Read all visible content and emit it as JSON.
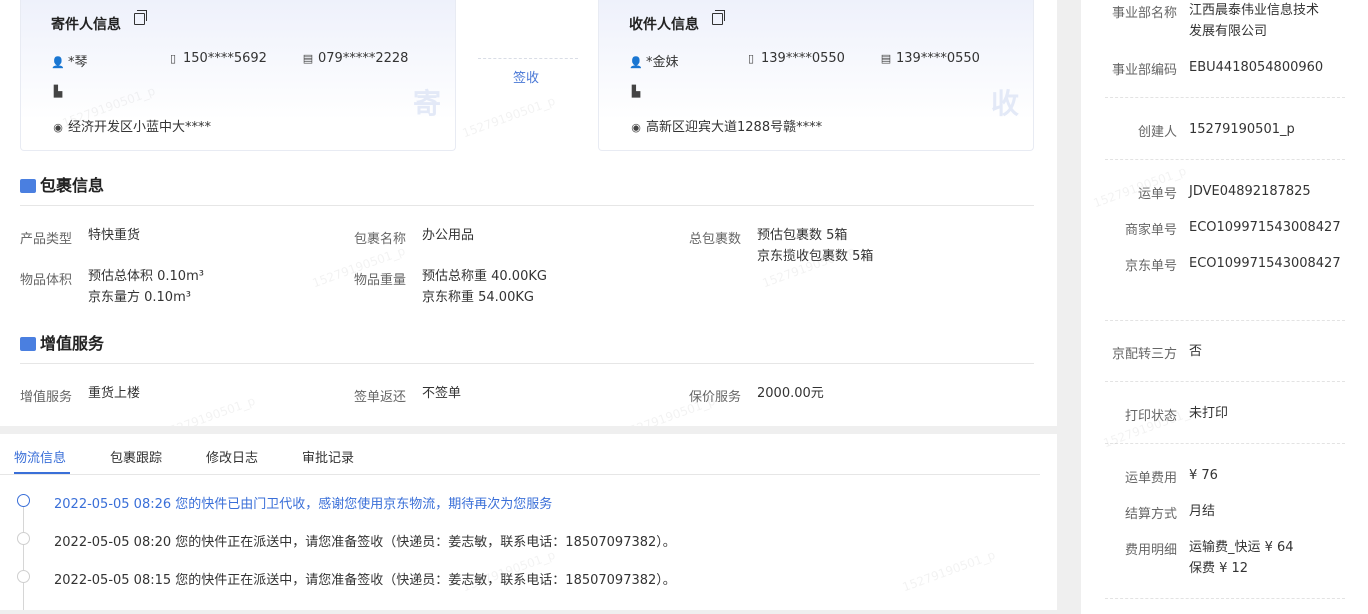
{
  "sender": {
    "title": "寄件人信息",
    "name": "*琴",
    "phone": "150****5692",
    "tel": "079*****2228",
    "address": "经济开发区小蓝中大****",
    "mark": "寄"
  },
  "receiver": {
    "title": "收件人信息",
    "name": "*金妹",
    "phone": "139****0550",
    "tel": "139****0550",
    "address": "高新区迎宾大道1288号赣****",
    "mark": "收"
  },
  "sign_status": "签收",
  "package": {
    "title": "包裹信息",
    "product_type_label": "产品类型",
    "product_type": "特快重货",
    "package_name_label": "包裹名称",
    "package_name": "办公用品",
    "total_count_label": "总包裹数",
    "total_count_1": "预估包裹数 5箱",
    "total_count_2": "京东揽收包裹数 5箱",
    "volume_label": "物品体积",
    "volume_1": "预估总体积 0.10m³",
    "volume_2": "京东量方 0.10m³",
    "weight_label": "物品重量",
    "weight_1": "预估总称重 40.00KG",
    "weight_2": "京东称重 54.00KG"
  },
  "value_added": {
    "title": "增值服务",
    "service_label": "增值服务",
    "service": "重货上楼",
    "return_label": "签单返还",
    "return": "不签单",
    "insurance_label": "保价服务",
    "insurance": "2000.00元"
  },
  "tabs": [
    "物流信息",
    "包裹跟踪",
    "修改日志",
    "审批记录"
  ],
  "timeline": [
    {
      "time": "2022-05-05 08:26",
      "text": "您的快件已由门卫代收，感谢您使用京东物流，期待再次为您服务"
    },
    {
      "time": "2022-05-05 08:20",
      "text": "您的快件正在派送中，请您准备签收（快递员：姜志敏，联系电话：18507097382）。"
    },
    {
      "time": "2022-05-05 08:15",
      "text": "您的快件正在派送中，请您准备签收（快递员：姜志敏，联系电话：18507097382）。"
    }
  ],
  "side": {
    "dept_name_label": "事业部名称",
    "dept_name_1": "江西晨泰伟业信息技术",
    "dept_name_2": "发展有限公司",
    "dept_code_label": "事业部编码",
    "dept_code": "EBU4418054800960",
    "creator_label": "创建人",
    "creator": "15279190501_p",
    "waybill_label": "运单号",
    "waybill": "JDVE04892187825",
    "merchant_label": "商家单号",
    "merchant": "ECO109971543008427",
    "jd_label": "京东单号",
    "jd": "ECO109971543008427",
    "third_label": "京配转三方",
    "third": "否",
    "print_label": "打印状态",
    "print": "未打印",
    "fee_label": "运单费用",
    "fee": "¥ 76",
    "settle_label": "结算方式",
    "settle": "月结",
    "detail_label": "费用明细",
    "detail_1": "运输费_快运 ¥ 64",
    "detail_2": "保费 ¥ 12"
  },
  "watermark": "15279190501_p",
  "colors": {
    "accent": "#3a6fd8",
    "package_icon": "#4a7fe0",
    "service_icon": "#4a7fe0"
  }
}
